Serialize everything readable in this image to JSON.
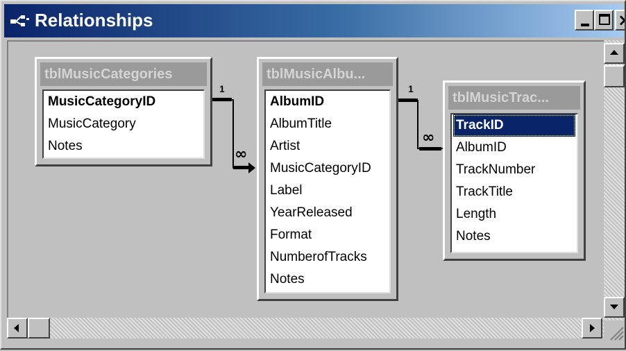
{
  "window": {
    "title": "Relationships",
    "icons": {
      "title": "relationships-icon",
      "minimize": "minimize-icon",
      "maximize": "maximize-icon",
      "close": "close-icon"
    }
  },
  "tables": [
    {
      "name": "tblMusicCategories",
      "fields": [
        {
          "label": "MusicCategoryID",
          "key": true
        },
        {
          "label": "MusicCategory",
          "key": false
        },
        {
          "label": "Notes",
          "key": false
        }
      ]
    },
    {
      "name": "tblMusicAlbu...",
      "fields": [
        {
          "label": "AlbumID",
          "key": true
        },
        {
          "label": "AlbumTitle",
          "key": false
        },
        {
          "label": "Artist",
          "key": false
        },
        {
          "label": "MusicCategoryID",
          "key": false
        },
        {
          "label": "Label",
          "key": false
        },
        {
          "label": "YearReleased",
          "key": false
        },
        {
          "label": "Format",
          "key": false
        },
        {
          "label": "NumberofTracks",
          "key": false
        },
        {
          "label": "Notes",
          "key": false
        }
      ]
    },
    {
      "name": "tblMusicTrac...",
      "fields": [
        {
          "label": "TrackID",
          "key": true,
          "selected": true
        },
        {
          "label": "AlbumID",
          "key": false
        },
        {
          "label": "TrackNumber",
          "key": false
        },
        {
          "label": "TrackTitle",
          "key": false
        },
        {
          "label": "Length",
          "key": false
        },
        {
          "label": "Notes",
          "key": false
        }
      ]
    }
  ],
  "relationships": [
    {
      "one_label": "1",
      "many_label": "∞"
    },
    {
      "one_label": "1",
      "many_label": "∞"
    }
  ],
  "scrollbars": {
    "icons": {
      "up": "arrow-up-icon",
      "down": "arrow-down-icon",
      "left": "arrow-left-icon",
      "right": "arrow-right-icon"
    }
  }
}
